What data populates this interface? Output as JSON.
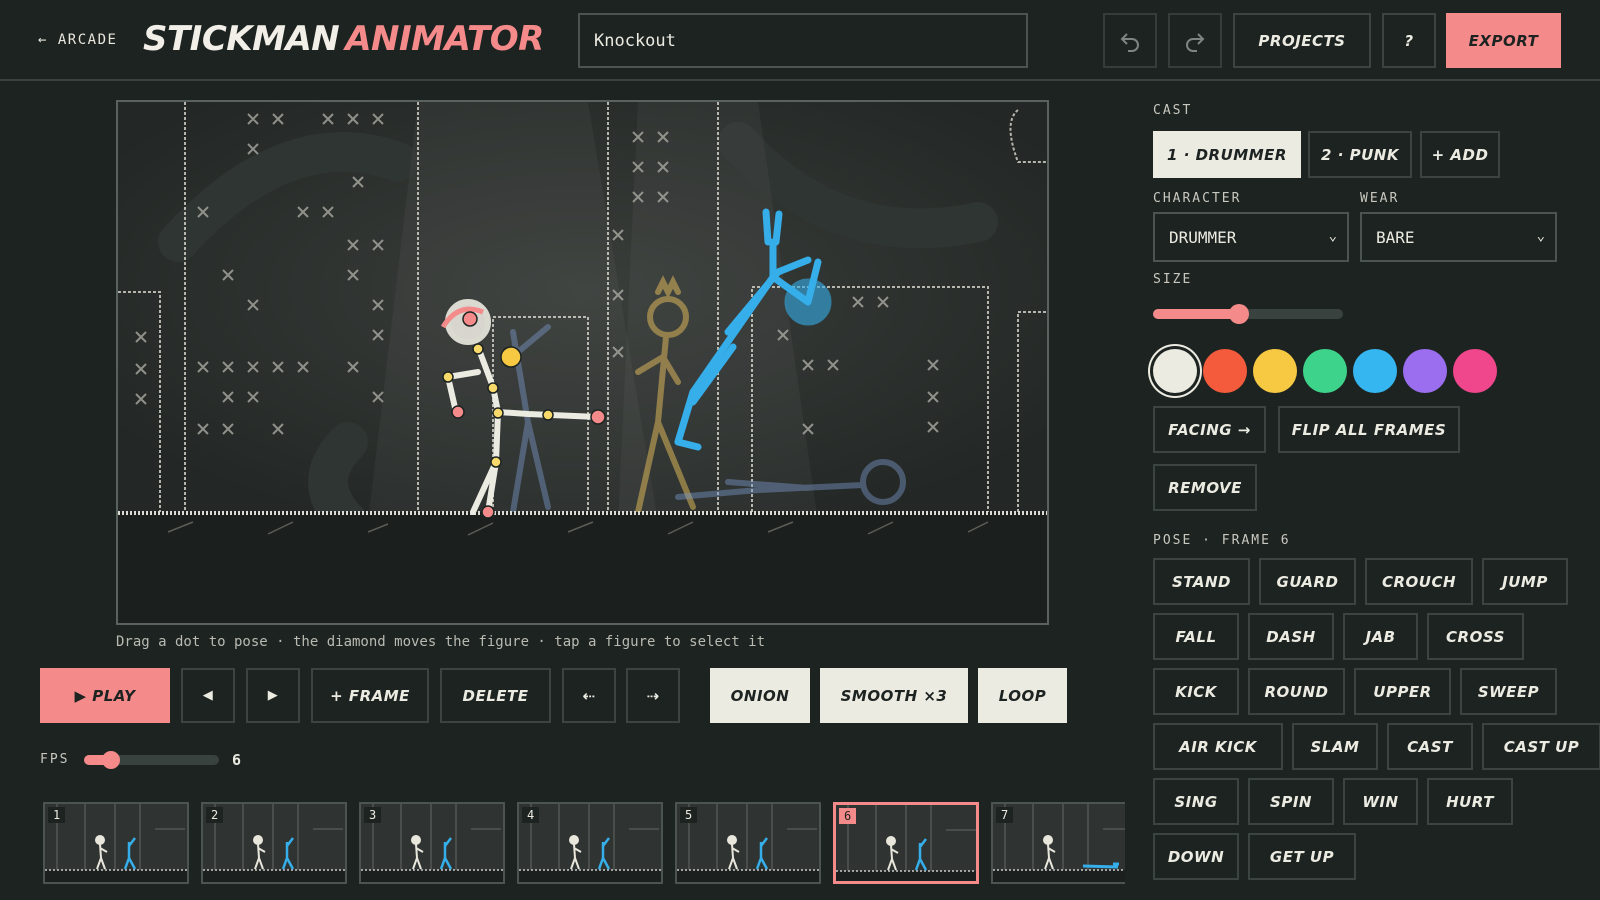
{
  "header": {
    "back_label": "← ARCADE",
    "logo_word1": "STICKMAN",
    "logo_word2": "ANIMATOR",
    "project_name": "Knockout",
    "projects_label": "PROJECTS",
    "help_label": "?",
    "export_label": "EXPORT"
  },
  "stage": {
    "hint": "Drag a dot to pose · the diamond moves the figure · tap a figure to select it"
  },
  "controls": {
    "play": "▶ PLAY",
    "prev": "◀",
    "next": "▶",
    "add_frame": "+ FRAME",
    "delete": "DELETE",
    "move_left": "⇠",
    "move_right": "⇢",
    "onion": "ONION",
    "smooth": "SMOOTH ×3",
    "loop": "LOOP",
    "fps_label": "FPS",
    "fps_value": "6",
    "fps_fraction": 0.2
  },
  "timeline": {
    "frames": [
      "1",
      "2",
      "3",
      "4",
      "5",
      "6",
      "7"
    ],
    "active_index": 5
  },
  "panel": {
    "cast_label": "CAST",
    "cast": [
      "1 · DRUMMER",
      "2 · PUNK",
      "+ ADD"
    ],
    "character_label": "CHARACTER",
    "character_value": "DRUMMER",
    "wear_label": "WEAR",
    "wear_value": "BARE",
    "size_label": "SIZE",
    "size_fraction": 0.45,
    "colors": [
      "#ecebe2",
      "#f45a3c",
      "#f7c943",
      "#3ed38a",
      "#36b6f0",
      "#9b6ef0",
      "#f0468c"
    ],
    "selected_color_index": 0,
    "facing": "FACING →",
    "flip_all": "FLIP ALL FRAMES",
    "remove": "REMOVE",
    "pose_label": "POSE · FRAME 6",
    "poses": [
      "STAND",
      "GUARD",
      "CROUCH",
      "JUMP",
      "FALL",
      "DASH",
      "JAB",
      "CROSS",
      "KICK",
      "ROUND",
      "UPPER",
      "SWEEP",
      "AIR KICK",
      "SLAM",
      "CAST",
      "CAST UP",
      "SING",
      "SPIN",
      "WIN",
      "HURT",
      "DOWN",
      "GET UP"
    ]
  },
  "accent_colors": {
    "pink": "#f58a8a",
    "background": "#1c2321",
    "light": "#ecebe2"
  }
}
